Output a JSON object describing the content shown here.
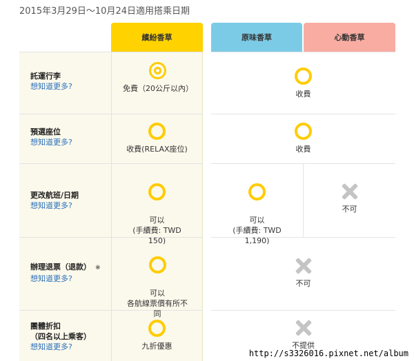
{
  "period": "2015年3月29日～10月24日適用搭乘日期",
  "plans": {
    "flex": "繽紛香草",
    "original": "原味香草",
    "heart": "心動香草"
  },
  "more_link": "想知道更多?",
  "rows": {
    "baggage": {
      "label": "託運行李",
      "flex_text": "免費（20公斤以內）",
      "other_text": "收費"
    },
    "seat": {
      "label": "預選座位",
      "flex_text": "收費(RELAX座位)",
      "other_text": "收費"
    },
    "change": {
      "label": "更改航班/日期",
      "flex_text": "可以\n(手續費: TWD\n150)",
      "original_text": "可以\n(手續費: TWD\n1,190)",
      "heart_text": "不可"
    },
    "refund": {
      "label": "辦理退票（退款）",
      "note": "※",
      "flex_text": "可以\n各航線票價有所不\n同",
      "other_text": "不可"
    },
    "group": {
      "label": "團體折扣\n（四名以上乘客）",
      "flex_text": "九折優惠",
      "other_text": "不提供"
    }
  },
  "watermark": "http://s3326016.pixnet.net/album",
  "colors": {
    "flex": "#ffd200",
    "original": "#7ccbe6",
    "heart": "#f8aca2",
    "mark": "#ffcc00",
    "cross": "#c4c4c4",
    "link": "#2a6fb8"
  },
  "icons": {
    "double_circle": "double-circle-icon",
    "circle": "circle-icon",
    "cross": "cross-icon"
  }
}
